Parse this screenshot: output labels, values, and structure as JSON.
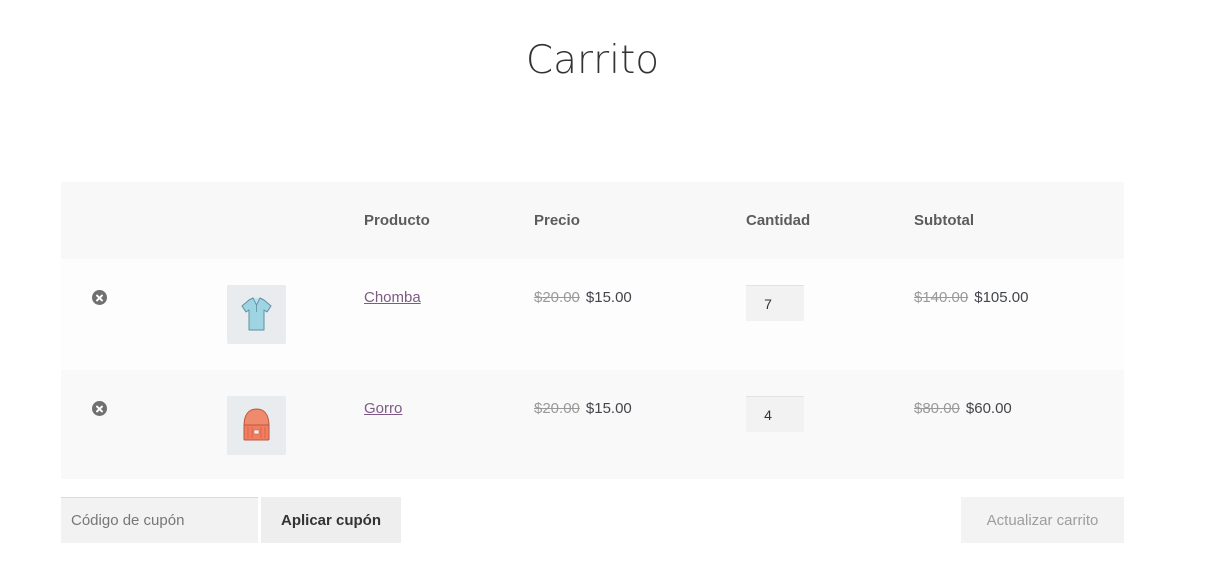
{
  "page": {
    "title": "Carrito"
  },
  "cart": {
    "columns": {
      "product": "Producto",
      "price": "Precio",
      "quantity": "Cantidad",
      "subtotal": "Subtotal"
    },
    "items": [
      {
        "name": "Chomba",
        "thumbnail_icon": "polo-shirt-icon",
        "regular_price": "$20.00",
        "sale_price": "$15.00",
        "quantity": "7",
        "regular_subtotal": "$140.00",
        "sale_subtotal": "$105.00"
      },
      {
        "name": "Gorro",
        "thumbnail_icon": "beanie-icon",
        "regular_price": "$20.00",
        "sale_price": "$15.00",
        "quantity": "4",
        "regular_subtotal": "$80.00",
        "sale_subtotal": "$60.00"
      }
    ]
  },
  "actions": {
    "coupon_placeholder": "Código de cupón",
    "apply_coupon_label": "Aplicar cupón",
    "update_cart_label": "Actualizar carrito"
  },
  "colors": {
    "link": "#7e5a86",
    "header_bg": "#f8f8f8",
    "remove_icon": "#707070"
  }
}
